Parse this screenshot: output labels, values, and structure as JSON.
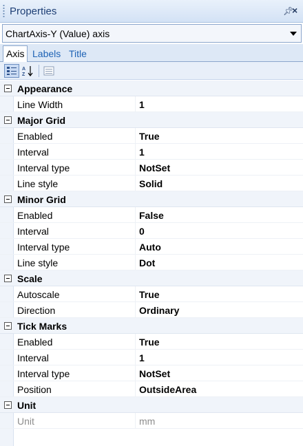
{
  "window": {
    "title": "Properties",
    "pin_icon": "pin-icon",
    "close_icon": "close-icon"
  },
  "selector": {
    "value": "ChartAxis-Y (Value) axis"
  },
  "tabs": [
    {
      "label": "Axis",
      "active": true
    },
    {
      "label": "Labels",
      "active": false
    },
    {
      "label": "Title",
      "active": false
    }
  ],
  "toolbar": {
    "categorized_icon": "categorized-icon",
    "alphabetical_icon": "sort-az-icon",
    "property_pages_icon": "property-pages-icon"
  },
  "categories": [
    {
      "label": "Appearance",
      "rows": [
        {
          "name": "Line Width",
          "value": "1"
        }
      ]
    },
    {
      "label": "Major Grid",
      "rows": [
        {
          "name": "Enabled",
          "value": "True"
        },
        {
          "name": "Interval",
          "value": "1"
        },
        {
          "name": "Interval type",
          "value": "NotSet"
        },
        {
          "name": "Line style",
          "value": "Solid"
        }
      ]
    },
    {
      "label": "Minor Grid",
      "rows": [
        {
          "name": "Enabled",
          "value": "False"
        },
        {
          "name": "Interval",
          "value": "0"
        },
        {
          "name": "Interval type",
          "value": "Auto"
        },
        {
          "name": "Line style",
          "value": "Dot"
        }
      ]
    },
    {
      "label": "Scale",
      "rows": [
        {
          "name": "Autoscale",
          "value": "True"
        },
        {
          "name": "Direction",
          "value": "Ordinary"
        }
      ]
    },
    {
      "label": "Tick Marks",
      "rows": [
        {
          "name": "Enabled",
          "value": "True"
        },
        {
          "name": "Interval",
          "value": "1"
        },
        {
          "name": "Interval type",
          "value": "NotSet"
        },
        {
          "name": "Position",
          "value": "OutsideArea"
        }
      ]
    },
    {
      "label": "Unit",
      "rows": [
        {
          "name": "Unit",
          "value": "mm",
          "disabled": true
        }
      ]
    }
  ]
}
